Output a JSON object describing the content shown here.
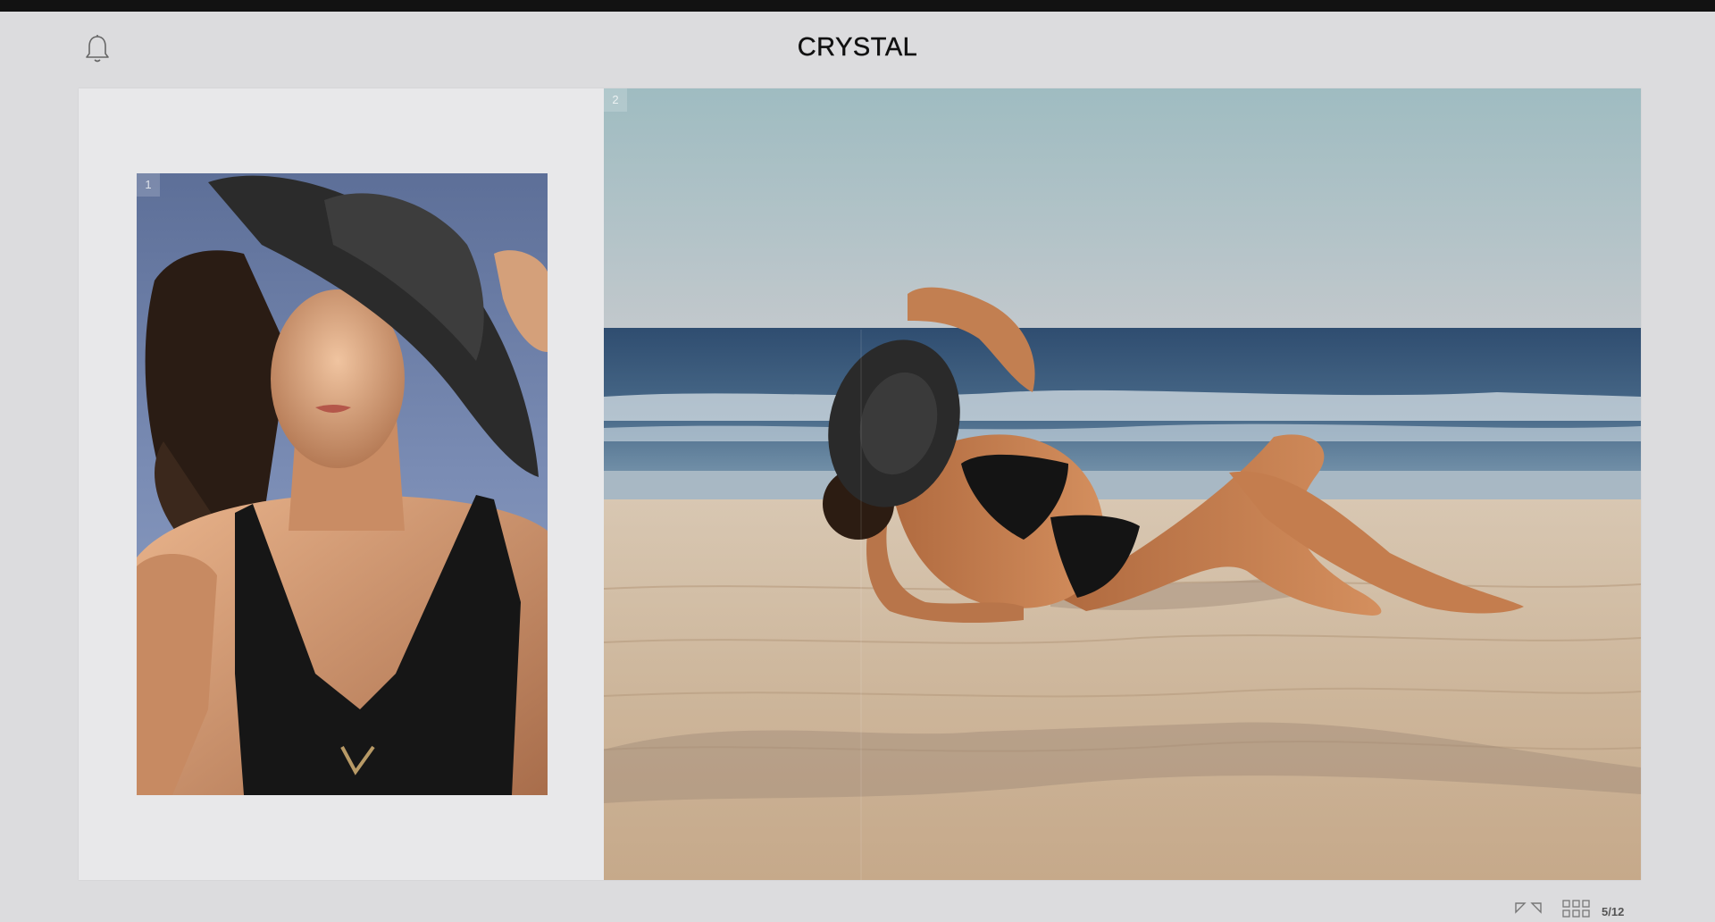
{
  "app": {
    "title": "CRYSTAL"
  },
  "header": {
    "notification_icon": "bell-icon"
  },
  "spread": {
    "photos": [
      {
        "index_label": "1",
        "description_icon": "portrait-photo"
      },
      {
        "index_label": "2",
        "description_icon": "beach-photo"
      }
    ]
  },
  "footer": {
    "fullscreen_icon": "expand-arrows-icon",
    "grid_icon": "grid-icon",
    "page_counter": "5/12"
  },
  "colors": {
    "background": "#dcdcde",
    "spread_bg": "#e8e8ea",
    "topbar": "#121212",
    "title_text": "#111111"
  }
}
